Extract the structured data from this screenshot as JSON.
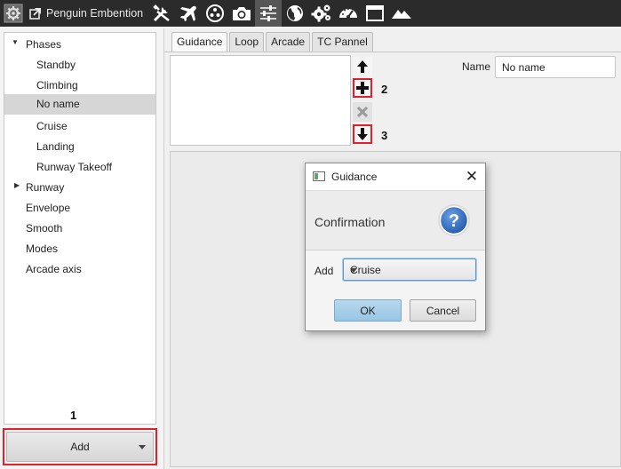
{
  "app": {
    "title": "Penguin Embention",
    "toolbar_icons": [
      "tools-icon",
      "airplane-icon",
      "dots-circle-icon",
      "camera-icon",
      "sliders-icon",
      "globe-icon",
      "gears-icon",
      "gauge-icon",
      "window-icon",
      "mountains-icon"
    ],
    "active_toolbar_icon": "sliders-icon"
  },
  "tree": {
    "items": [
      {
        "label": "Phases",
        "level": 1,
        "expanded": true
      },
      {
        "label": "Standby",
        "level": 2
      },
      {
        "label": "Climbing",
        "level": 2
      },
      {
        "label": "No name",
        "level": 2,
        "selected": true
      },
      {
        "label": "Cruise",
        "level": 2
      },
      {
        "label": "Landing",
        "level": 2
      },
      {
        "label": "Runway Takeoff",
        "level": 2
      },
      {
        "label": "Runway",
        "level": 1,
        "expanded": false
      },
      {
        "label": "Envelope",
        "level": 1
      },
      {
        "label": "Smooth",
        "level": 1
      },
      {
        "label": "Modes",
        "level": 1
      },
      {
        "label": "Arcade axis",
        "level": 1
      }
    ]
  },
  "add_button": {
    "label": "Add"
  },
  "annotations": {
    "one": "1",
    "two": "2",
    "three": "3"
  },
  "tabs": [
    {
      "label": "Guidance",
      "active": true
    },
    {
      "label": "Loop"
    },
    {
      "label": "Arcade"
    },
    {
      "label": "TC Pannel"
    }
  ],
  "name_field": {
    "label": "Name",
    "value": "No name"
  },
  "dialog": {
    "title": "Guidance",
    "heading": "Confirmation",
    "add_label": "Add",
    "selected_option": "Cruise",
    "ok_label": "OK",
    "cancel_label": "Cancel"
  },
  "colors": {
    "toolbar_bg": "#2b2b2b",
    "highlight_red": "#e0202a",
    "help_blue": "#2f6fc1",
    "ok_blue": "#a9d0eb"
  }
}
